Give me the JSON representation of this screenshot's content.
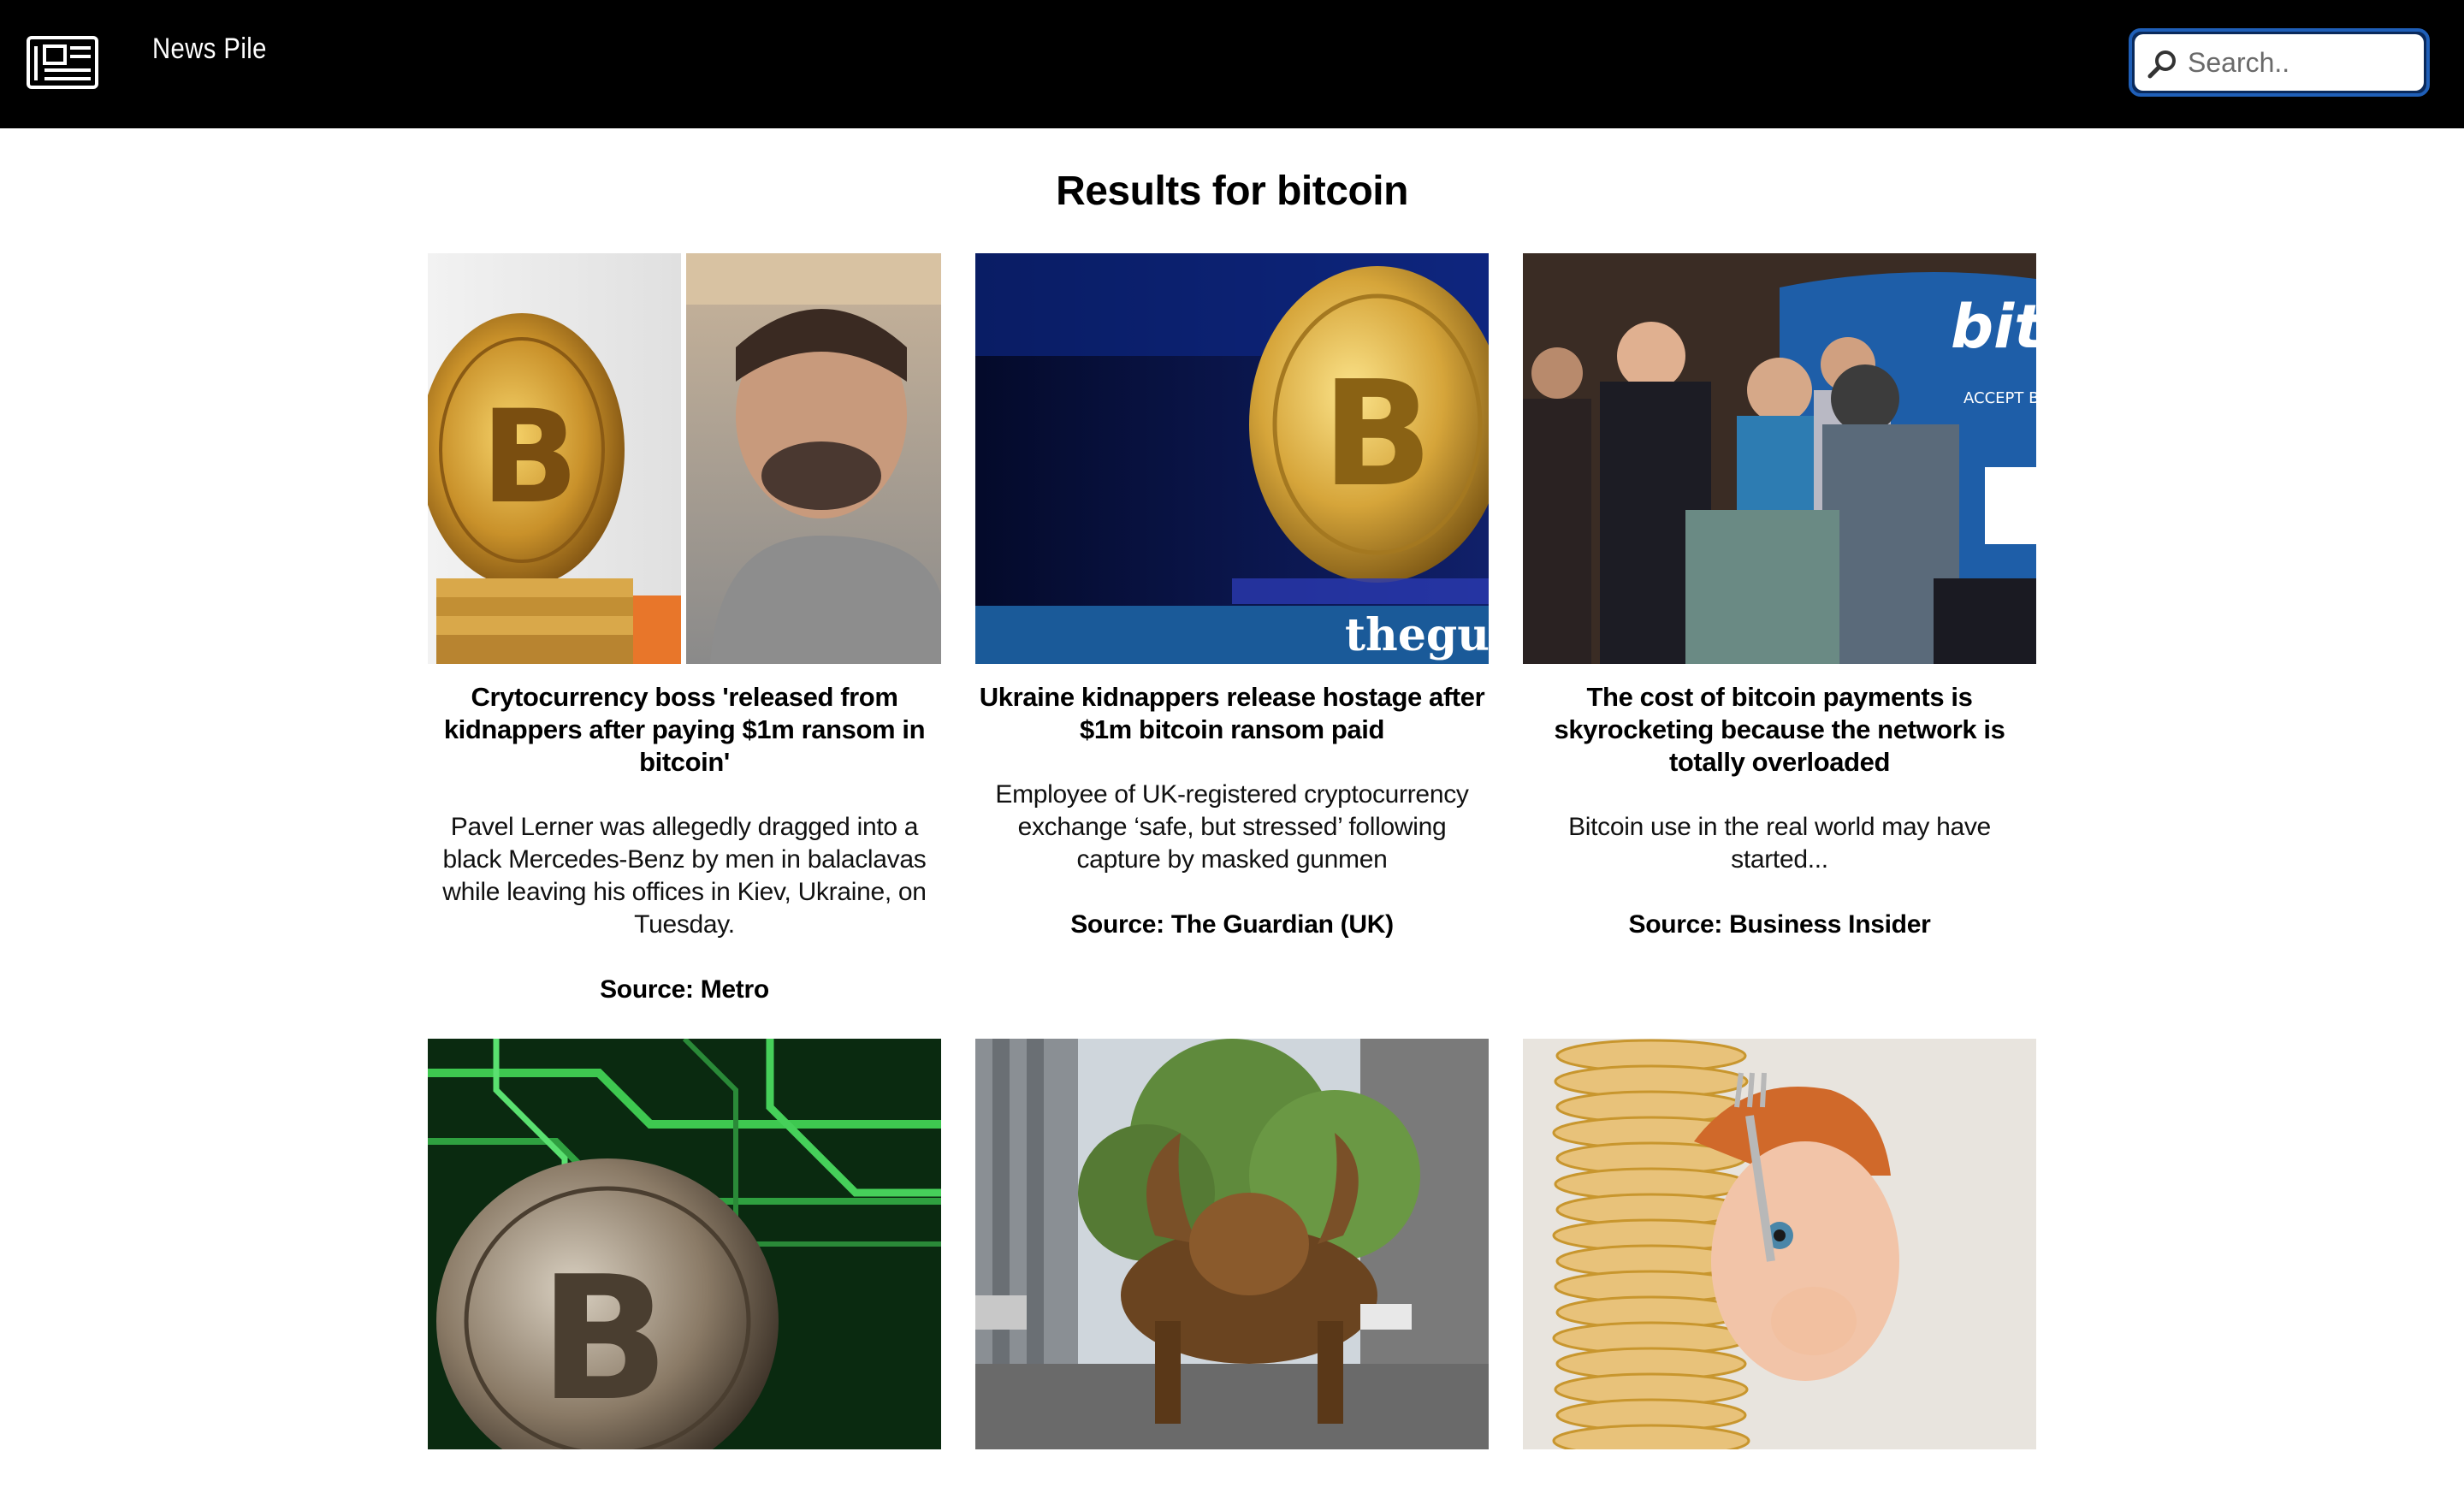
{
  "header": {
    "brand": "News Pile",
    "logo_icon": "newspaper-icon",
    "search": {
      "placeholder": "Search..",
      "value": "",
      "icon": "search-icon"
    }
  },
  "main": {
    "title": "Results for bitcoin",
    "articles": [
      {
        "title": "Crytocurrency boss 'released from kidnappers after paying $1m ransom in bitcoin'",
        "description": "Pavel Lerner was allegedly dragged into a black Mercedes-Benz by men in balaclavas while leaving his offices in Kiev, Ukraine, on Tuesday.",
        "source": "Source: Metro"
      },
      {
        "title": "Ukraine kidnappers release hostage after $1m bitcoin ransom paid",
        "description": "Employee of UK-registered cryptocurrency exchange ‘safe, but stressed’ following capture by masked gunmen",
        "source": "Source: The Guardian (UK)",
        "image_watermark": "theguа"
      },
      {
        "title": "The cost of bitcoin payments is skyrocketing because the network is totally overloaded",
        "description": "Bitcoin use in the real world may have started...",
        "source": "Source: Business Insider",
        "image_sign_text": "bitp",
        "image_sign_sub": "ACCEPT BIT"
      },
      {
        "title": "",
        "description": "",
        "source": ""
      },
      {
        "title": "",
        "description": "",
        "source": ""
      },
      {
        "title": "",
        "description": "",
        "source": ""
      }
    ]
  }
}
